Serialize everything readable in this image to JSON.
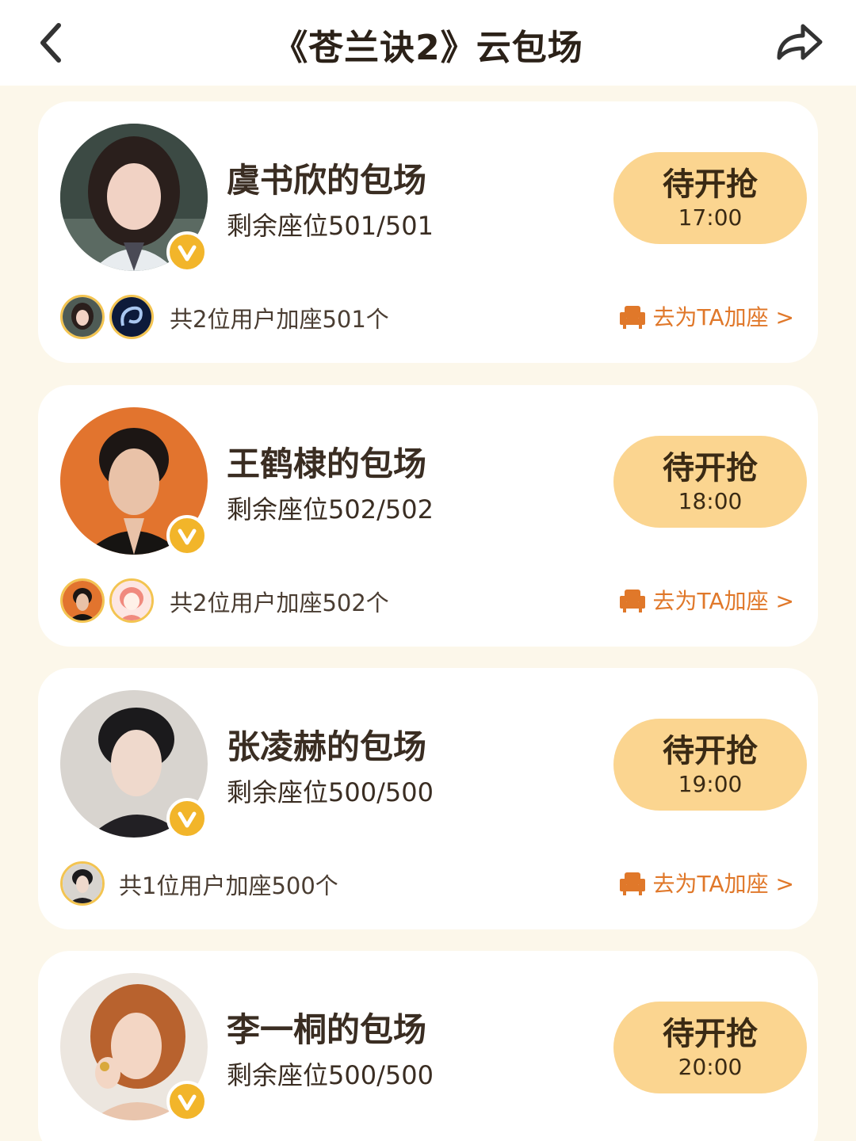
{
  "header": {
    "title": "《苍兰诀2》云包场",
    "back_icon": "chevron-left-icon",
    "share_icon": "share-arrow-icon"
  },
  "theme": {
    "page_bg": "#fcf7ea",
    "button_bg": "#fbd590",
    "accent": "#e0782a",
    "badge": "#f2b52a"
  },
  "screenings": [
    {
      "host": "虞书欣的包场",
      "seats": "剩余座位501/501",
      "status": "待开抢",
      "time": "17:00",
      "joined": "共2位用户加座501个",
      "add_seat": "去为TA加座 >"
    },
    {
      "host": "王鹤棣的包场",
      "seats": "剩余座位502/502",
      "status": "待开抢",
      "time": "18:00",
      "joined": "共2位用户加座502个",
      "add_seat": "去为TA加座 >"
    },
    {
      "host": "张凌赫的包场",
      "seats": "剩余座位500/500",
      "status": "待开抢",
      "time": "19:00",
      "joined": "共1位用户加座500个",
      "add_seat": "去为TA加座 >"
    },
    {
      "host": "李一桐的包场",
      "seats": "剩余座位500/500",
      "status": "待开抢",
      "time": "20:00"
    }
  ]
}
